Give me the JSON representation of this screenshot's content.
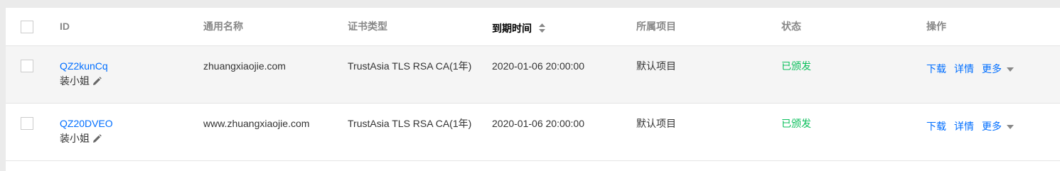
{
  "header": {
    "id": "ID",
    "common_name": "通用名称",
    "cert_type": "证书类型",
    "expiry": "到期时间",
    "project": "所属项目",
    "status": "状态",
    "actions": "操作"
  },
  "rows": [
    {
      "id": "QZ2kunCq",
      "alias": "装小姐",
      "common_name": "zhuangxiaojie.com",
      "cert_type": "TrustAsia TLS RSA CA(1年)",
      "expiry": "2020-01-06 20:00:00",
      "project": "默认项目",
      "status": "已颁发"
    },
    {
      "id": "QZ20DVEO",
      "alias": "装小姐",
      "common_name": "www.zhuangxiaojie.com",
      "cert_type": "TrustAsia TLS RSA CA(1年)",
      "expiry": "2020-01-06 20:00:00",
      "project": "默认项目",
      "status": "已颁发"
    }
  ],
  "actions": {
    "download": "下载",
    "details": "详情",
    "more": "更多"
  },
  "colors": {
    "link": "#006eff",
    "status_issued": "#0abf5b",
    "hover_row": "#f5f5f5"
  }
}
